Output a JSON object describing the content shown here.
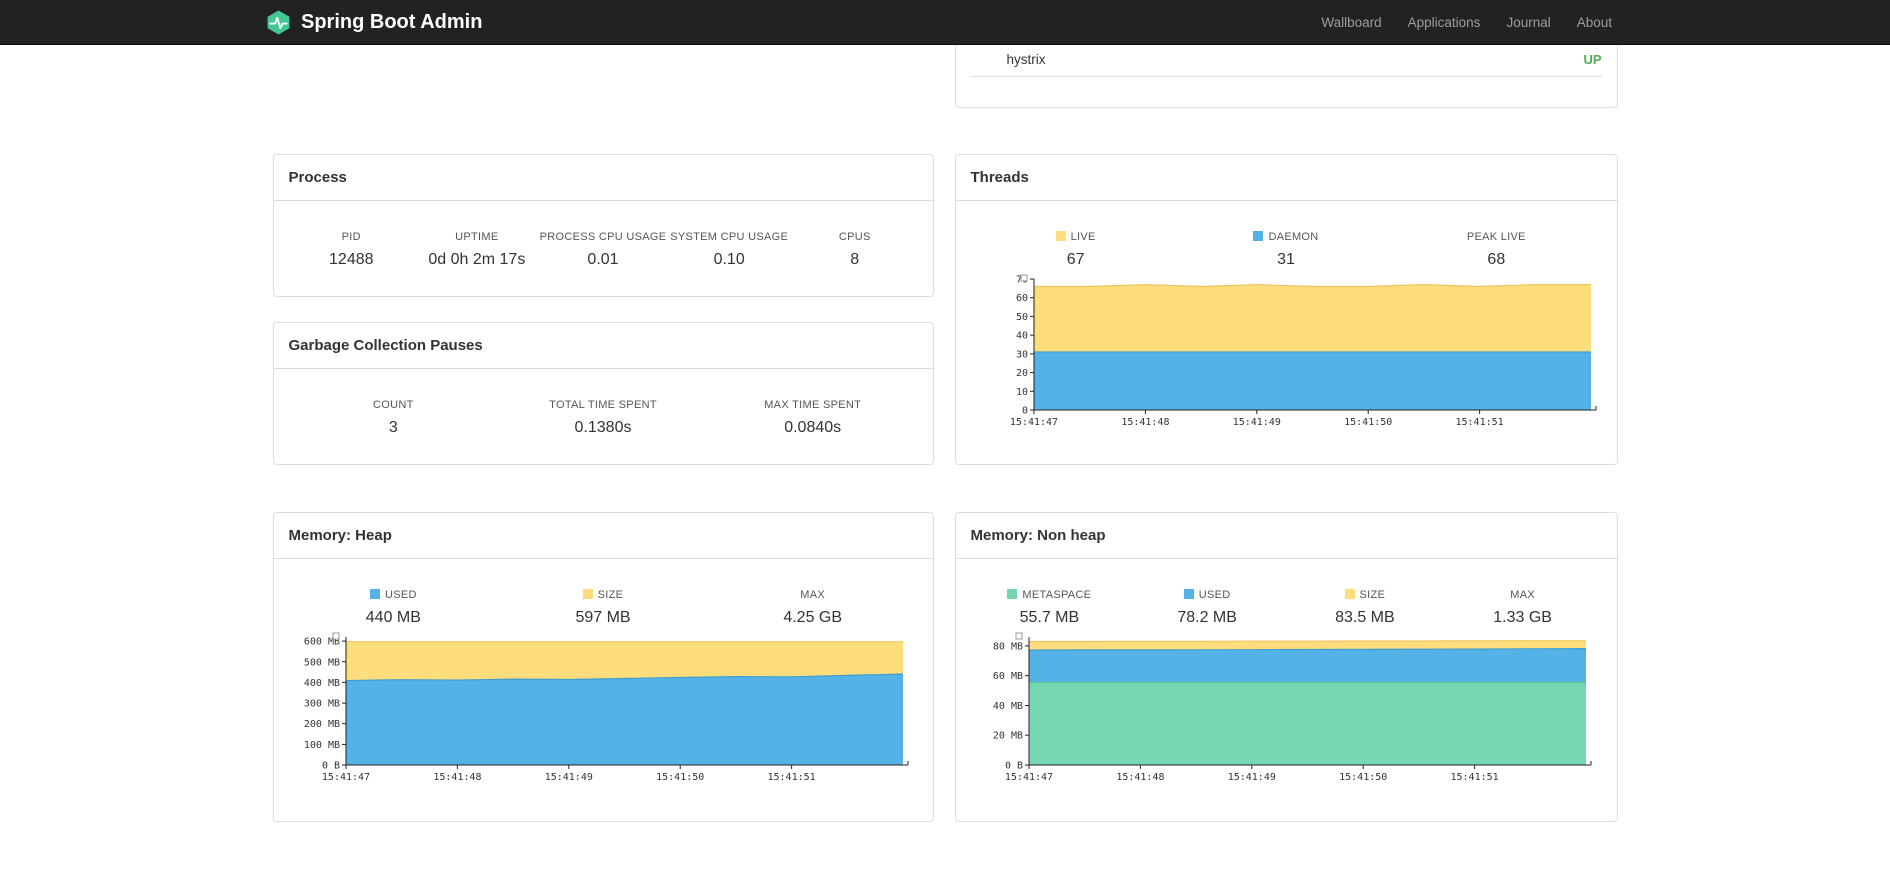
{
  "navbar": {
    "brand": "Spring Boot Admin",
    "logo_color": "#42c795",
    "links": [
      {
        "label": "Wallboard"
      },
      {
        "label": "Applications"
      },
      {
        "label": "Journal"
      },
      {
        "label": "About"
      }
    ]
  },
  "hystrix_panel": {
    "name": "hystrix",
    "status": "UP",
    "status_color": "#4caf50"
  },
  "process": {
    "title": "Process",
    "stats": [
      {
        "label": "PID",
        "value": "12488"
      },
      {
        "label": "UPTIME",
        "value": "0d 0h 2m 17s"
      },
      {
        "label": "PROCESS CPU USAGE",
        "value": "0.01"
      },
      {
        "label": "SYSTEM CPU USAGE",
        "value": "0.10"
      },
      {
        "label": "CPUS",
        "value": "8"
      }
    ]
  },
  "gc": {
    "title": "Garbage Collection Pauses",
    "stats": [
      {
        "label": "COUNT",
        "value": "3"
      },
      {
        "label": "TOTAL TIME SPENT",
        "value": "0.1380s"
      },
      {
        "label": "MAX TIME SPENT",
        "value": "0.0840s"
      }
    ]
  },
  "threads": {
    "title": "Threads",
    "legend": [
      {
        "label": "LIVE",
        "value": "67",
        "swatch": "#ffdd7c"
      },
      {
        "label": "DAEMON",
        "value": "31",
        "swatch": "#55b2e6"
      },
      {
        "label": "PEAK LIVE",
        "value": "68",
        "swatch": null
      }
    ]
  },
  "heap": {
    "title": "Memory: Heap",
    "legend": [
      {
        "label": "USED",
        "value": "440 MB",
        "swatch": "#55b2e6"
      },
      {
        "label": "SIZE",
        "value": "597 MB",
        "swatch": "#ffdd7c"
      },
      {
        "label": "MAX",
        "value": "4.25 GB",
        "swatch": null
      }
    ]
  },
  "nonheap": {
    "title": "Memory: Non heap",
    "legend": [
      {
        "label": "METASPACE",
        "value": "55.7 MB",
        "swatch": "#74d7b1"
      },
      {
        "label": "USED",
        "value": "78.2 MB",
        "swatch": "#55b2e6"
      },
      {
        "label": "SIZE",
        "value": "83.5 MB",
        "swatch": "#ffdd7c"
      },
      {
        "label": "MAX",
        "value": "1.33 GB",
        "swatch": null
      }
    ]
  },
  "chart_data": [
    {
      "id": "threads",
      "type": "area",
      "title": "Threads",
      "x_labels": [
        "15:41:47",
        "15:41:48",
        "15:41:49",
        "15:41:50",
        "15:41:51"
      ],
      "ylim": [
        0,
        70
      ],
      "yticks": [
        0,
        10,
        20,
        30,
        40,
        50,
        60,
        70
      ],
      "ytick_labels": [
        "0",
        "10",
        "20",
        "30",
        "40",
        "50",
        "60",
        "70"
      ],
      "series": [
        {
          "name": "LIVE",
          "color": "#ffdd7c",
          "edge": "#eec45f",
          "values": [
            66,
            66,
            67,
            66,
            67,
            66,
            66,
            67,
            66,
            67,
            67
          ]
        },
        {
          "name": "DAEMON",
          "color": "#55b2e6",
          "edge": "#3e9ed2",
          "values": [
            31,
            31,
            31,
            31,
            31,
            31,
            31,
            31,
            31,
            31,
            31
          ]
        }
      ]
    },
    {
      "id": "heap",
      "type": "area",
      "title": "Memory: Heap",
      "x_labels": [
        "15:41:47",
        "15:41:48",
        "15:41:49",
        "15:41:50",
        "15:41:51"
      ],
      "ylim": [
        0,
        620
      ],
      "yticks": [
        0,
        100,
        200,
        300,
        400,
        500,
        600
      ],
      "ytick_labels": [
        "0 B",
        "100 MB",
        "200 MB",
        "300 MB",
        "400 MB",
        "500 MB",
        "600 MB"
      ],
      "series": [
        {
          "name": "SIZE",
          "color": "#ffdd7c",
          "edge": "#eec45f",
          "values": [
            597,
            597,
            597,
            597,
            597,
            597,
            597,
            597,
            597,
            597,
            597
          ]
        },
        {
          "name": "USED",
          "color": "#55b2e6",
          "edge": "#3e9ed2",
          "values": [
            409,
            413,
            411,
            416,
            414,
            419,
            424,
            428,
            427,
            434,
            441
          ]
        }
      ]
    },
    {
      "id": "nonheap",
      "type": "area",
      "title": "Memory: Non heap",
      "x_labels": [
        "15:41:47",
        "15:41:48",
        "15:41:49",
        "15:41:50",
        "15:41:51"
      ],
      "ylim": [
        0,
        86
      ],
      "yticks": [
        0,
        20,
        40,
        60,
        80
      ],
      "ytick_labels": [
        "0 B",
        "20 MB",
        "40 MB",
        "60 MB",
        "80 MB"
      ],
      "series": [
        {
          "name": "SIZE",
          "color": "#ffdd7c",
          "edge": "#eec45f",
          "values": [
            83,
            83,
            83.1,
            83.1,
            83.2,
            83.2,
            83.3,
            83.3,
            83.4,
            83.5,
            83.5
          ]
        },
        {
          "name": "USED",
          "color": "#55b2e6",
          "edge": "#3e9ed2",
          "values": [
            77.2,
            77.3,
            77.3,
            77.4,
            77.5,
            77.6,
            77.7,
            77.8,
            77.9,
            78.1,
            78.2
          ]
        },
        {
          "name": "METASPACE",
          "color": "#74d7b1",
          "edge": "#54bf96",
          "values": [
            55.7,
            55.7,
            55.7,
            55.7,
            55.7,
            55.7,
            55.7,
            55.7,
            55.7,
            55.7,
            55.7
          ]
        }
      ]
    }
  ]
}
